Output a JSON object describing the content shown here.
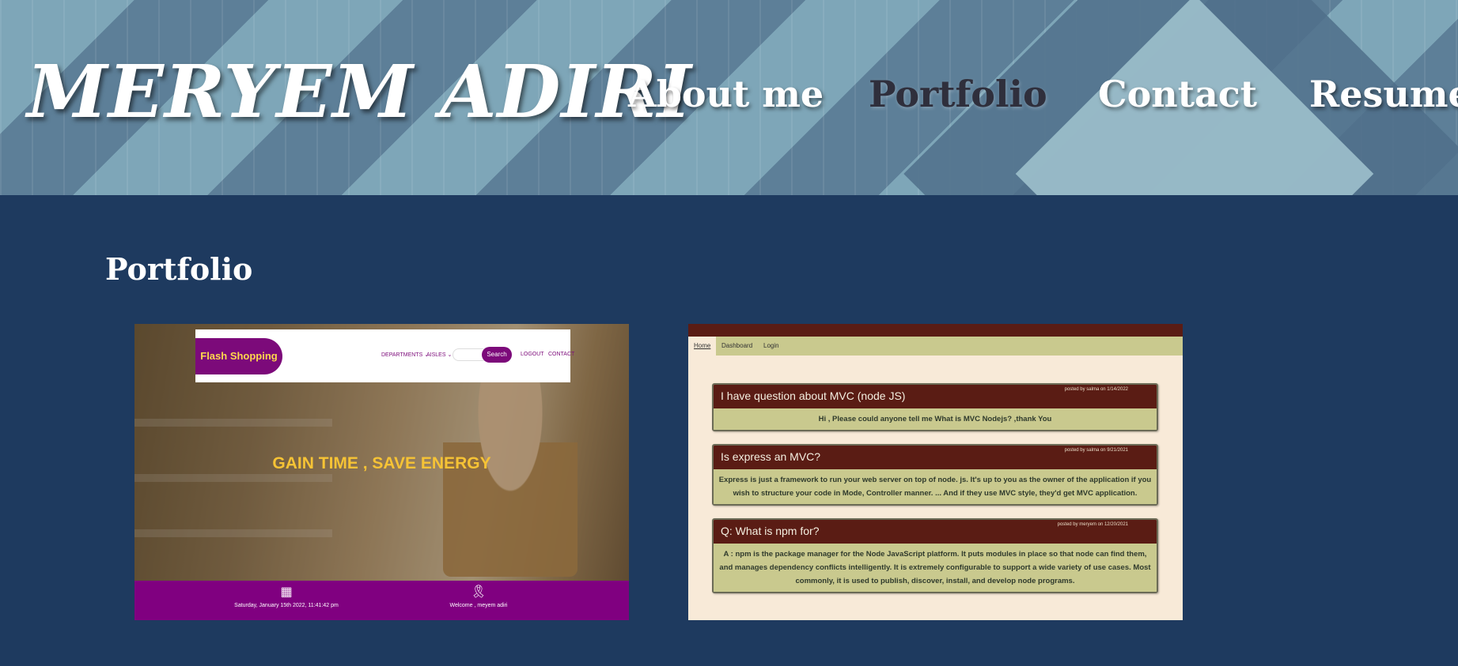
{
  "header": {
    "site_name": "MERYEM ADIRI",
    "nav": [
      {
        "label": "About me",
        "active": false
      },
      {
        "label": "Portfolio",
        "active": true
      },
      {
        "label": "Contact",
        "active": false
      },
      {
        "label": "Resume",
        "active": false
      }
    ]
  },
  "colors": {
    "page_background": "#1e3a5f",
    "shop_purple": "#800080",
    "shop_hero_text": "#f6c335",
    "forum_maroon": "#5a1c14",
    "forum_olive": "#c9c98e"
  },
  "section": {
    "title": "Portfolio"
  },
  "projects": {
    "shop": {
      "brand": "Flash Shopping",
      "menu": [
        "DEPARTMENTS ⌄",
        "AISLES ⌄"
      ],
      "search_button": "Search",
      "links": [
        "LOGOUT",
        "CONTACT"
      ],
      "hero": "GAIN TIME , SAVE ENERGY",
      "footer_date": "Saturday, January 15th 2022, 11:41:42 pm",
      "footer_welcome": "Welcome , meyem adiri",
      "footer_icons": [
        "calendar-icon",
        "ribbon-icon"
      ]
    },
    "forum": {
      "nav": [
        "Home",
        "Dashboard",
        "Login"
      ],
      "posts": [
        {
          "title": "I have question about MVC (node JS)",
          "meta": "posted by salma on 1/14/2022",
          "body": "Hi , Please could anyone tell me What is MVC Nodejs? ,thank You"
        },
        {
          "title": "Is express an MVC?",
          "meta": "posted by salma on 9/21/2021",
          "body": "Express is just a framework to run your web server on top of node. js. It's up to you as the owner of the application if you wish to structure your code in Mode, Controller manner. ... And if they use MVC style, they'd get MVC application."
        },
        {
          "title": "Q: What is npm for?",
          "meta": "posted by meryem on 12/20/2021",
          "body": "A : npm is the package manager for the Node JavaScript platform. It puts modules in place so that node can find them, and manages dependency conflicts intelligently. It is extremely configurable to support a wide variety of use cases. Most commonly, it is used to publish, discover, install, and develop node programs."
        }
      ]
    }
  }
}
